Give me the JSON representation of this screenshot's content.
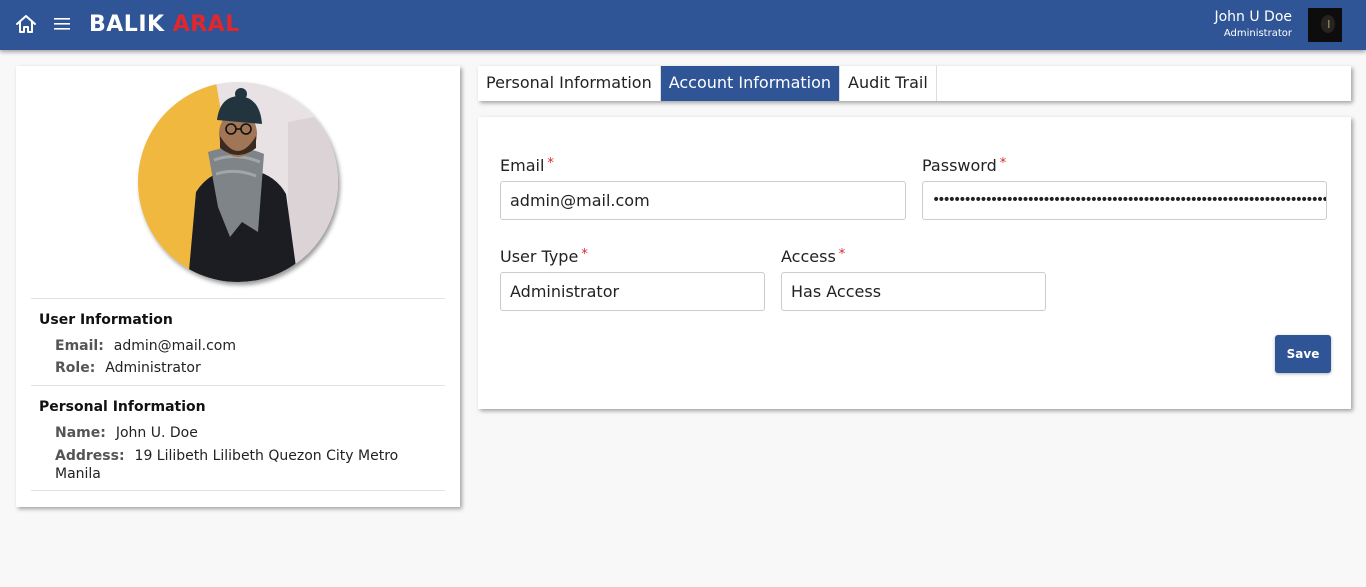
{
  "header": {
    "brand_main": "BALIK ",
    "brand_accent": "ARAL",
    "user_name": "John U Doe",
    "user_role": "Administrator",
    "bg_color": "#2f5597",
    "accent_color": "#e3262b"
  },
  "profile": {
    "user_info_title": "User Information",
    "email_label": "Email:",
    "email_value": "admin@mail.com",
    "role_label": "Role:",
    "role_value": "Administrator",
    "personal_info_title": "Personal Information",
    "name_label": "Name:",
    "name_value": "John U. Doe",
    "address_label": "Address:",
    "address_value": "19 Lilibeth Lilibeth Quezon City Metro Manila"
  },
  "tabs": [
    {
      "label": "Personal Information",
      "active": false
    },
    {
      "label": "Account Information",
      "active": true
    },
    {
      "label": "Audit Trail",
      "active": false
    }
  ],
  "form": {
    "email_label": "Email",
    "email_value": "admin@mail.com",
    "password_label": "Password",
    "password_value": "••••••••••••••••••••••••••••••••••••••••••••••••••••••••••••••••••••••••••••••••",
    "user_type_label": "User Type",
    "user_type_value": "Administrator",
    "access_label": "Access",
    "access_value": "Has Access",
    "required_mark": "*",
    "save_label": "Save"
  }
}
